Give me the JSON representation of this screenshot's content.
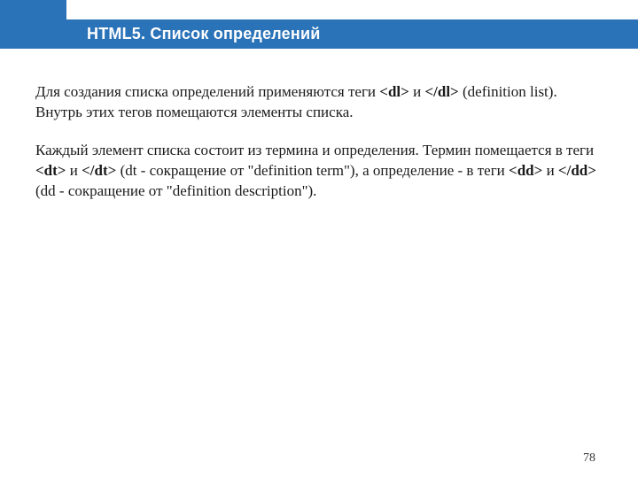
{
  "header": {
    "title": "HTML5. Список определений"
  },
  "body": {
    "p1_s1": "Для создания списка определений применяются теги ",
    "p1_b1": "<dl>",
    "p1_s2": " и ",
    "p1_b2": "</dl>",
    "p1_s3": " (definition list). Внутрь этих тегов помещаются элементы списка.",
    "p2_s1": "Каждый элемент списка состоит из термина и определения. Термин помещается в теги ",
    "p2_b1": "<dt>",
    "p2_s2": " и ",
    "p2_b2": "</dt>",
    "p2_s3": " (dt - сокращение от \"definition term\"), а определение - в теги ",
    "p2_b3": "<dd>",
    "p2_s4": " и ",
    "p2_b4": "</dd>",
    "p2_s5": " (dd - сокращение от \"definition description\")."
  },
  "footer": {
    "page": "78"
  }
}
